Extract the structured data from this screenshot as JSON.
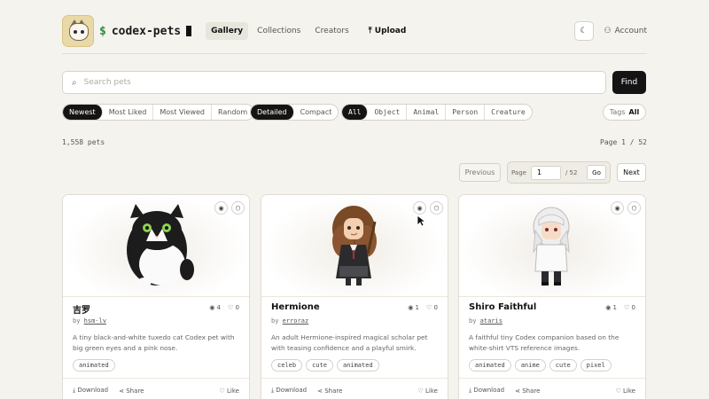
{
  "header": {
    "brand_prefix": "$",
    "brand_name": "codex-pets",
    "nav": [
      "Gallery",
      "Collections",
      "Creators"
    ],
    "upload": "Upload",
    "account": "Account"
  },
  "search": {
    "placeholder": "Search pets",
    "button": "Find"
  },
  "filters": {
    "sort": [
      "Newest",
      "Most Liked",
      "Most Viewed",
      "Random"
    ],
    "sort_selected": "Newest",
    "view": [
      "Detailed",
      "Compact"
    ],
    "view_selected": "Detailed",
    "type": [
      "All",
      "Object",
      "Animal",
      "Person",
      "Creature"
    ],
    "type_selected": "All",
    "tags_label": "Tags",
    "tags_value": "All"
  },
  "summary": {
    "count": "1,558 pets",
    "page": "Page 1 / 52"
  },
  "pagination": {
    "prev": "Previous",
    "page_label": "Page",
    "page_value": "1",
    "total": "/ 52",
    "go": "Go",
    "next": "Next"
  },
  "cards": [
    {
      "title": "吉罗",
      "views": "4",
      "likes": "0",
      "by": "by",
      "author": "hsm-lv",
      "desc": "A tiny black-and-white tuxedo cat Codex pet with big green eyes and a pink nose.",
      "tags": [
        "animated"
      ],
      "download": "Download",
      "share": "Share",
      "like": "Like"
    },
    {
      "title": "Hermione",
      "views": "1",
      "likes": "0",
      "by": "by",
      "author": "erroraz",
      "desc": "An adult Hermione-inspired magical scholar pet with teasing confidence and a playful smirk.",
      "tags": [
        "celeb",
        "cute",
        "animated"
      ],
      "download": "Download",
      "share": "Share",
      "like": "Like"
    },
    {
      "title": "Shiro Faithful",
      "views": "1",
      "likes": "0",
      "by": "by",
      "author": "ataris",
      "desc": "A faithful tiny Codex companion based on the white-shirt VTS reference images.",
      "tags": [
        "animated",
        "anime",
        "cute",
        "pixel"
      ],
      "download": "Download",
      "share": "Share",
      "like": "Like"
    }
  ]
}
